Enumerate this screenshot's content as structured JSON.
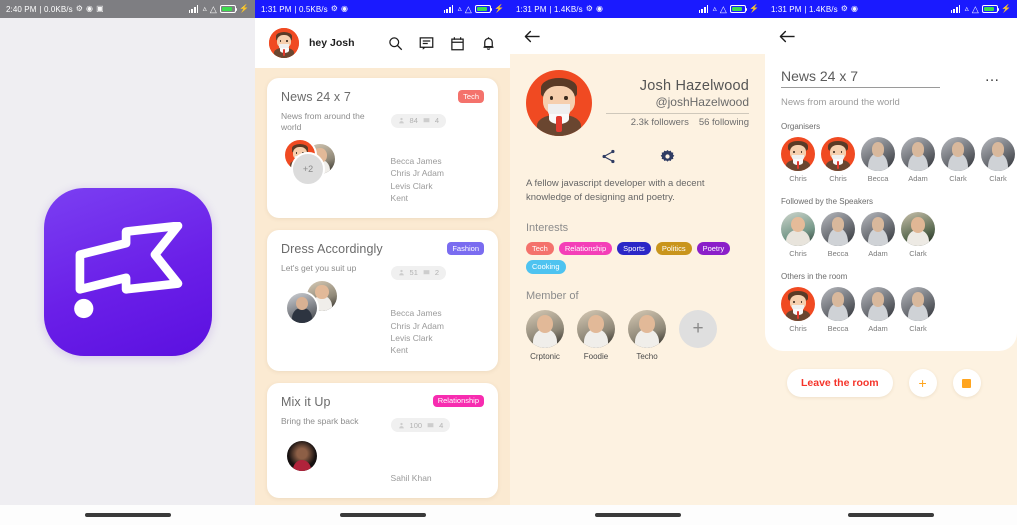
{
  "screens": [
    {
      "name": "splash",
      "statusbar": {
        "time": "2:40 PM",
        "net": "| 0.0KB/s",
        "icons": "status-icons"
      },
      "app_icon": "flag-logo-icon",
      "brand_color": "#6a1fe8"
    },
    {
      "name": "feed",
      "statusbar": {
        "time": "1:31 PM",
        "net": "| 0.5KB/s"
      },
      "header": {
        "greeting": "hey Josh",
        "icons": [
          "search-icon",
          "chat-icon",
          "calendar-icon",
          "bell-icon"
        ]
      },
      "cards": [
        {
          "title": "News 24 x 7",
          "badge": "Tech",
          "badge_color": "#f4726c",
          "subtitle": "News from around the world",
          "people_count": "84",
          "comment_count": "4",
          "overflow": "+2",
          "names": "Becca James\nChris Jr Adam\nLevis Clark\nKent"
        },
        {
          "title": "Dress Accordingly",
          "badge": "Fashion",
          "badge_color": "#7a6cf0",
          "subtitle": "Let's get you suit up",
          "people_count": "51",
          "comment_count": "2",
          "overflow": "",
          "names": "Becca James\nChris Jr Adam\nLevis Clark\nKent"
        },
        {
          "title": "Mix it Up",
          "badge": "Relationship",
          "badge_color": "#f72cb0",
          "subtitle": "Bring the spark back",
          "people_count": "100",
          "comment_count": "4",
          "overflow": "",
          "names": "Sahil Khan"
        }
      ]
    },
    {
      "name": "profile",
      "statusbar": {
        "time": "1:31 PM",
        "net": "| 1.4KB/s"
      },
      "back": "back-arrow-icon",
      "profile": {
        "name": "Josh Hazelwood",
        "handle": "@joshHazelwood",
        "followers": "2.3k followers",
        "following": "56 following",
        "bio": "A fellow javascript developer with a decent knowledge of designing and poetry.",
        "actions": [
          "share-icon",
          "gear-icon"
        ]
      },
      "interests_title": "Interests",
      "interests": [
        {
          "label": "Tech",
          "color": "#f4726c"
        },
        {
          "label": "Relationship",
          "color": "#f43fb8"
        },
        {
          "label": "Sports",
          "color": "#2b27c7"
        },
        {
          "label": "Politics",
          "color": "#c9951c"
        },
        {
          "label": "Poetry",
          "color": "#8b1fc9"
        },
        {
          "label": "Cooking",
          "color": "#4ec3f0"
        }
      ],
      "member_of_title": "Member of",
      "member_of": [
        {
          "label": "Crptonic"
        },
        {
          "label": "Foodie"
        },
        {
          "label": "Techo"
        }
      ],
      "add_label": "+"
    },
    {
      "name": "room",
      "statusbar": {
        "time": "1:31 PM",
        "net": "| 1.4KB/s"
      },
      "back": "back-arrow-icon",
      "room": {
        "title": "News 24 x 7",
        "menu": "…",
        "subtitle": "News from around the world",
        "sections": [
          {
            "label": "Organisers",
            "people": [
              {
                "name": "Chris",
                "avatar": "mascot"
              },
              {
                "name": "Chris",
                "avatar": "mascot"
              },
              {
                "name": "Becca",
                "avatar": "gray"
              },
              {
                "name": "Adam",
                "avatar": "gray"
              },
              {
                "name": "Clark",
                "avatar": "gray"
              },
              {
                "name": "Clark",
                "avatar": "gray"
              }
            ]
          },
          {
            "label": "Followed by the Speakers",
            "people": [
              {
                "name": "Chris",
                "avatar": "teal"
              },
              {
                "name": "Becca",
                "avatar": "gray"
              },
              {
                "name": "Adam",
                "avatar": "gray"
              },
              {
                "name": "Clark",
                "avatar": "green"
              }
            ]
          },
          {
            "label": "Others in the room",
            "people": [
              {
                "name": "Chris",
                "avatar": "mascot"
              },
              {
                "name": "Becca",
                "avatar": "gray"
              },
              {
                "name": "Adam",
                "avatar": "gray"
              },
              {
                "name": "Clark",
                "avatar": "gray"
              }
            ]
          }
        ],
        "leave_label": "Leave the room",
        "add_label": "+",
        "stop_label": "stop-square-icon"
      }
    }
  ]
}
